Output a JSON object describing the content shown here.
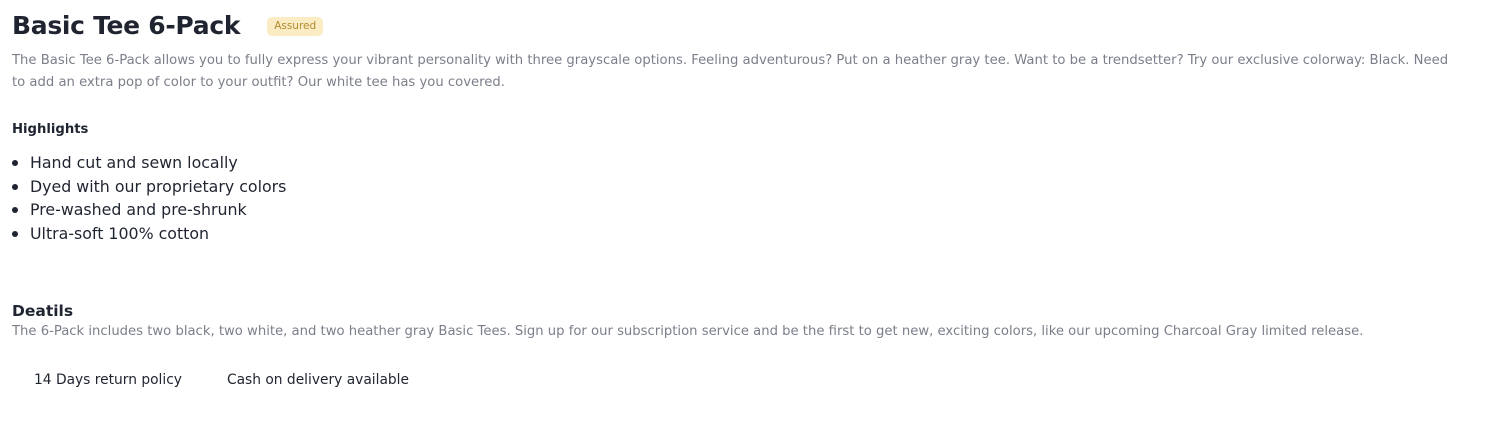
{
  "product": {
    "title": "Basic Tee 6-Pack",
    "badge": "Assured",
    "description": "The Basic Tee 6-Pack allows you to fully express your vibrant personality with three grayscale options. Feeling adventurous? Put on a heather gray tee. Want to be a trendsetter? Try our exclusive colorway: Black. Need to add an extra pop of color to your outfit? Our white tee has you covered."
  },
  "highlights": {
    "heading": "Highlights",
    "items": [
      "Hand cut and sewn locally",
      "Dyed with our proprietary colors",
      "Pre-washed and pre-shrunk",
      "Ultra-soft 100% cotton"
    ]
  },
  "details": {
    "heading": "Deatils",
    "text": "The 6-Pack includes two black, two white, and two heather gray Basic Tees. Sign up for our subscription service and be the first to get new, exciting colors, like our upcoming Charcoal Gray limited release."
  },
  "policies": {
    "items": [
      "14 Days return policy",
      "Cash on delivery available"
    ]
  },
  "colors": {
    "text_primary": "#1f2430",
    "text_secondary": "#7b7f8a",
    "badge_bg": "#fbecc4",
    "badge_text": "#b08b2e"
  }
}
